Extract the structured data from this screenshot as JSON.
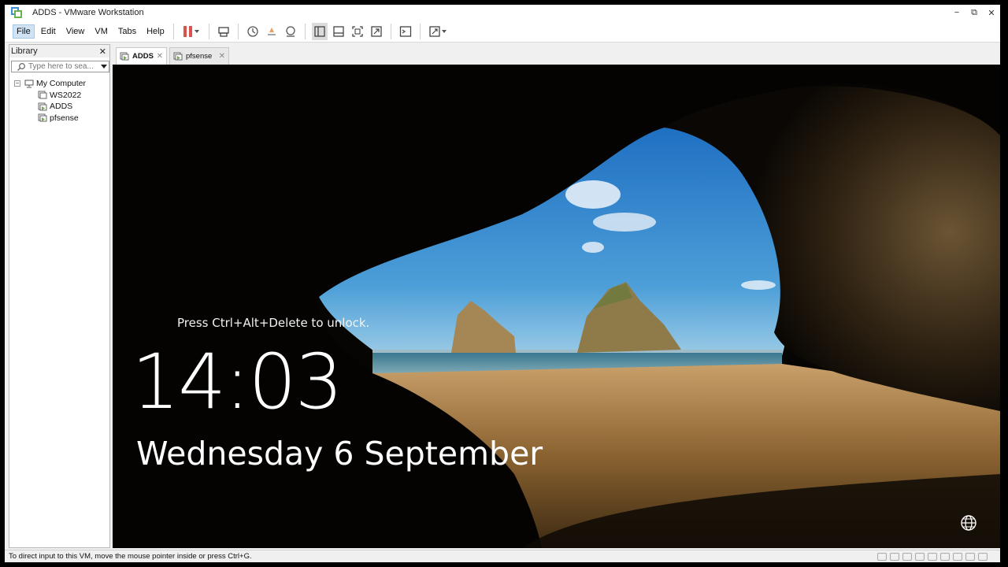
{
  "window": {
    "title": "ADDS - VMware Workstation",
    "controls": {
      "minimize": "−",
      "restore": "⧉",
      "close": "✕"
    }
  },
  "menubar": {
    "items": [
      {
        "label": "File",
        "active": true
      },
      {
        "label": "Edit"
      },
      {
        "label": "View"
      },
      {
        "label": "VM"
      },
      {
        "label": "Tabs"
      },
      {
        "label": "Help"
      }
    ],
    "toolbar_icons": [
      "pause-icon",
      "send-ctrl-alt-del-icon",
      "snapshot-icon",
      "revert-snapshot-icon",
      "snapshot-manager-icon",
      "library-view-icon",
      "thumbnail-bar-icon",
      "full-screen-icon",
      "unity-icon",
      "console-view-icon",
      "stretch-guest-icon"
    ]
  },
  "library": {
    "title": "Library",
    "close": "✕",
    "search_placeholder": "Type here to sea...",
    "root": "My Computer",
    "vms": [
      {
        "name": "WS2022",
        "state": "off"
      },
      {
        "name": "ADDS",
        "state": "running"
      },
      {
        "name": "pfsense",
        "state": "running"
      }
    ]
  },
  "tabs": [
    {
      "label": "ADDS",
      "active": true,
      "close": "✕"
    },
    {
      "label": "pfsense",
      "active": false,
      "close": "✕"
    }
  ],
  "lockscreen": {
    "message": "Press Ctrl+Alt+Delete to unlock.",
    "time": "14:03",
    "date": "Wednesday 6 September",
    "network_icon": "globe-icon"
  },
  "statusbar": {
    "text": "To direct input to this VM, move the mouse pointer inside or press Ctrl+G."
  },
  "colors": {
    "accent": "#3a8fd6",
    "running": "#6ab04c",
    "pause": "#d9534f"
  }
}
